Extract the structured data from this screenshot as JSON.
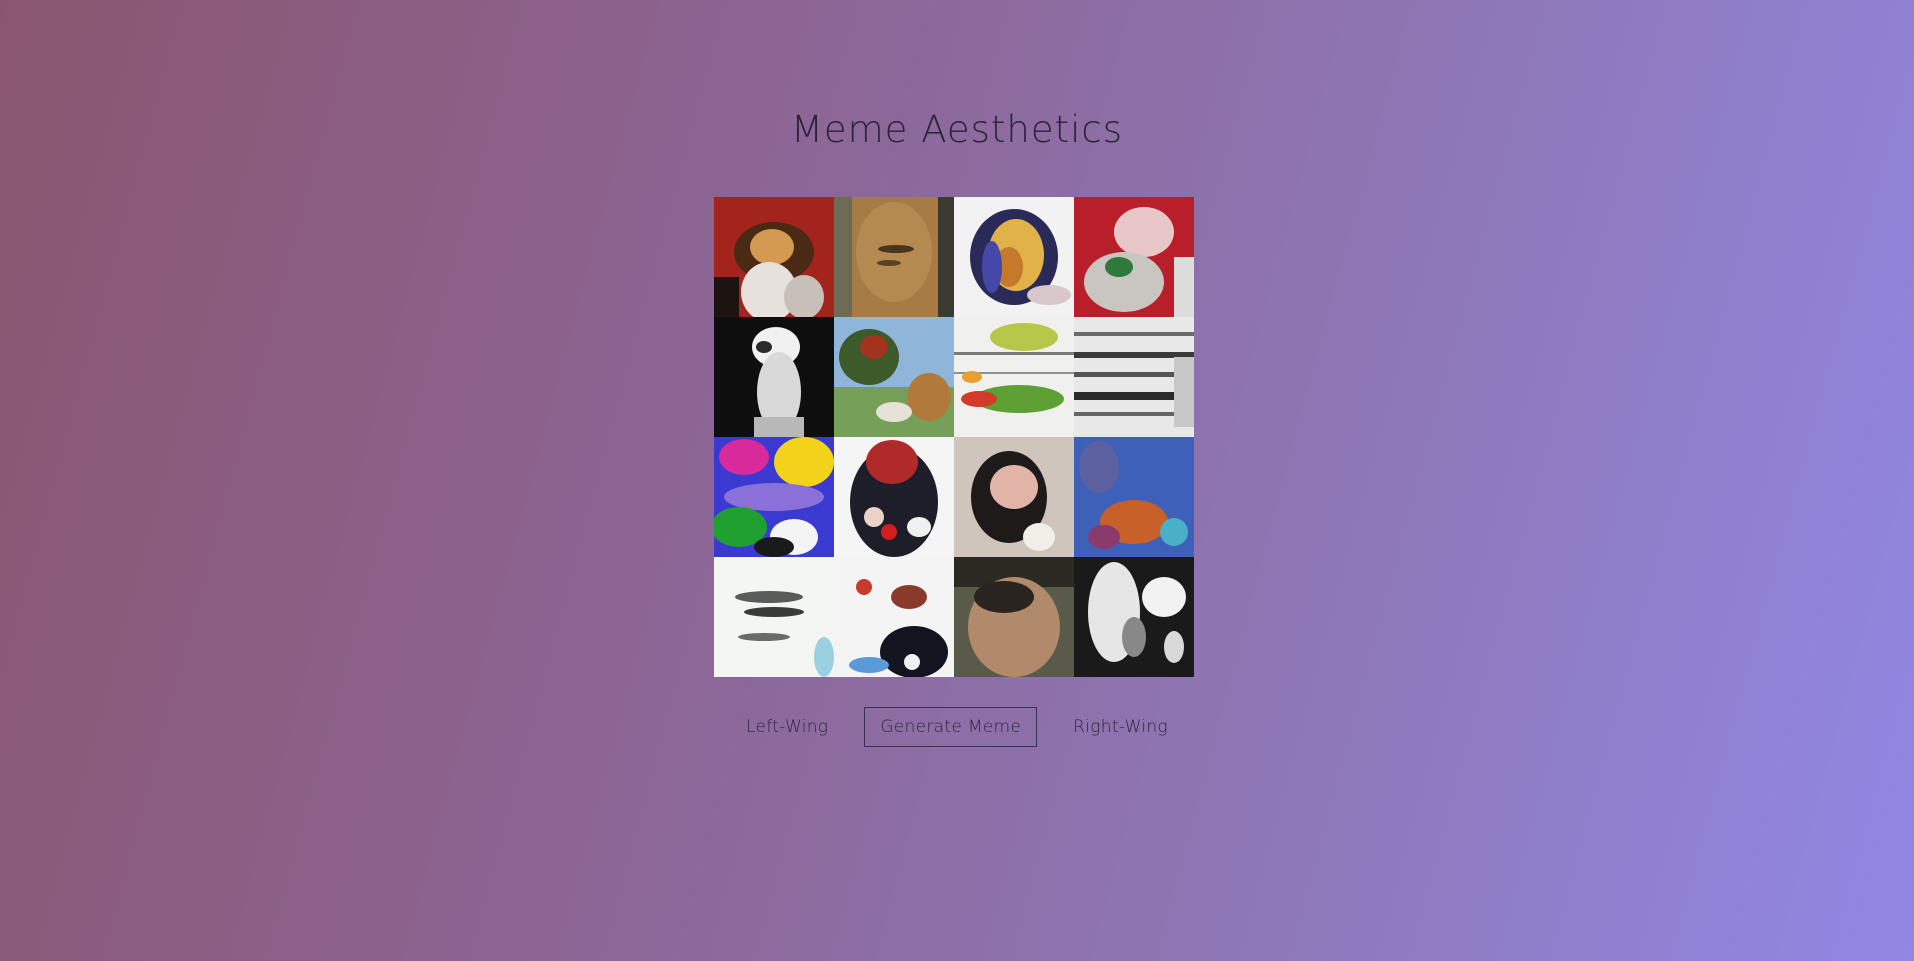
{
  "page": {
    "title": "Meme Aesthetics"
  },
  "grid": {
    "tiles": [
      {
        "name": "meme-tile-1"
      },
      {
        "name": "meme-tile-2"
      },
      {
        "name": "meme-tile-3"
      },
      {
        "name": "meme-tile-4"
      },
      {
        "name": "meme-tile-5"
      },
      {
        "name": "meme-tile-6"
      },
      {
        "name": "meme-tile-7"
      },
      {
        "name": "meme-tile-8"
      },
      {
        "name": "meme-tile-9"
      },
      {
        "name": "meme-tile-10"
      },
      {
        "name": "meme-tile-11"
      },
      {
        "name": "meme-tile-12"
      },
      {
        "name": "meme-tile-13"
      },
      {
        "name": "meme-tile-14"
      },
      {
        "name": "meme-tile-15"
      },
      {
        "name": "meme-tile-16"
      }
    ]
  },
  "controls": {
    "left_label": "Left-Wing",
    "generate_label": "Generate Meme",
    "right_label": "Right-Wing"
  },
  "colors": {
    "gradient_start": "#8a566f",
    "gradient_end": "#9187e4",
    "text": "#2a2236"
  }
}
